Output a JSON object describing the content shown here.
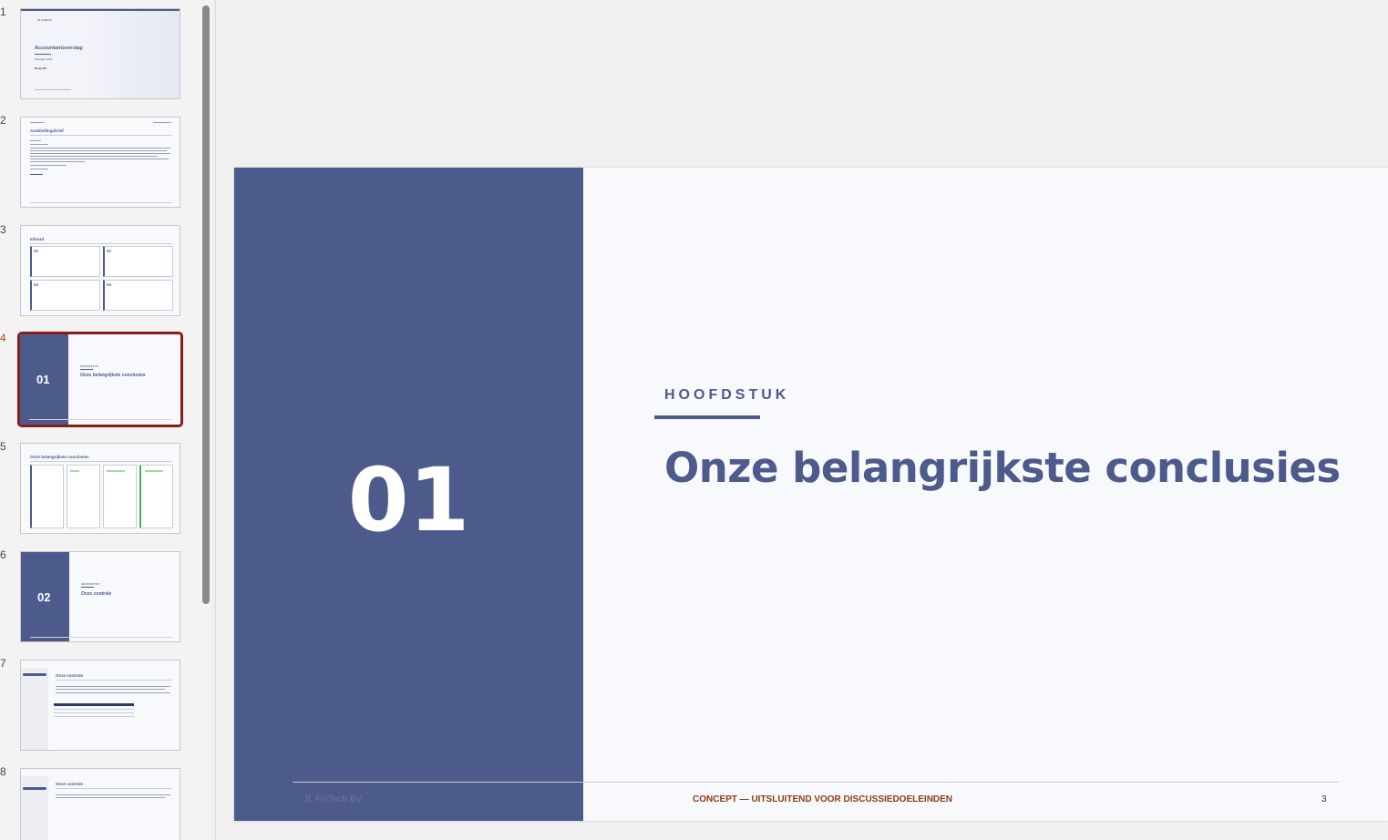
{
  "thumbnails": {
    "numbers": [
      "1",
      "2",
      "3",
      "4",
      "5",
      "6",
      "7",
      "8"
    ],
    "active_index": 4,
    "slide1": {
      "title": "Accountantsverslag",
      "subtitle": "Boekjaar 2025",
      "client": "Demo BV",
      "logo": "JL FinTech"
    },
    "slide2": {
      "title": "Aanbiedingsbrief"
    },
    "slide3": {
      "title": "Inhoud",
      "items": [
        "01",
        "02",
        "03",
        "04"
      ]
    },
    "slide4": {
      "number": "01",
      "kicker": "HOOFDSTUK",
      "title": "Onze belangrijkste conclusies"
    },
    "slide5": {
      "title": "Onze belangrijkste conclusies"
    },
    "slide6": {
      "number": "02",
      "kicker": "HOOFDSTUK",
      "title": "Onze controle"
    },
    "slide7": {
      "title": "Onze controle"
    },
    "slide8": {
      "title": "Onze controle"
    }
  },
  "slide": {
    "number": "01",
    "chapter_label": "HOOFDSTUK",
    "title": "Onze belangrijkste conclusies",
    "footer_company": "JL FinTech BV",
    "footer_concept": "CONCEPT — UITSLUITEND VOOR DISCUSSIEDOELEINDEN",
    "footer_page": "3"
  },
  "colors": {
    "accent": "#4d5a8c",
    "selected_border": "#8b1a1a",
    "concept_text": "#8b3a1a"
  }
}
